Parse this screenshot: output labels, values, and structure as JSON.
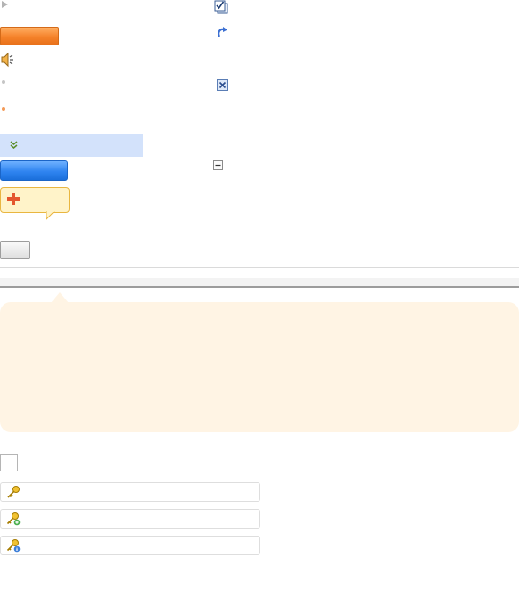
{
  "colors": {
    "accent_orange": "#f5822a",
    "accent_blue": "#2f84f0",
    "selection_blue": "#d3e2fb",
    "tooltip_fill": "#fff3c9",
    "callout_fill": "#fff4e4"
  },
  "icons": {
    "expand_arrow": "triangle-right-icon",
    "speaker": "speaker-icon",
    "double_chevron": "double-chevron-down-icon",
    "plus": "plus-icon",
    "checklist": "checklist-icon",
    "redo": "redo-icon",
    "close": "close-x-icon",
    "collapse": "collapse-minus-icon",
    "key": "key-icon",
    "key_add": "key-add-icon",
    "key_info": "key-info-icon"
  }
}
